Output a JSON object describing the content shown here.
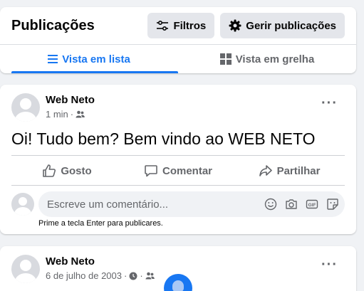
{
  "header": {
    "title": "Publicações",
    "filters_label": "Filtros",
    "manage_label": "Gerir publicações"
  },
  "tabs": [
    {
      "label": "Vista em lista",
      "active": true
    },
    {
      "label": "Vista em grelha",
      "active": false
    }
  ],
  "posts": [
    {
      "author": "Web Neto",
      "time": "1 min",
      "privacy_icon": "friends-icon",
      "text": "Oi! Tudo bem? Bem vindo ao WEB NETO",
      "actions": {
        "like": "Gosto",
        "comment": "Comentar",
        "share": "Partilhar"
      },
      "comment_placeholder": "Escreve um comentário...",
      "hint": "Prime a tecla Enter para publicares."
    },
    {
      "author": "Web Neto",
      "time": "6 de julho de 2003",
      "separator": "·"
    }
  ],
  "colors": {
    "accent": "#1877f2",
    "background": "#f0f2f5",
    "muted": "#65676b"
  }
}
